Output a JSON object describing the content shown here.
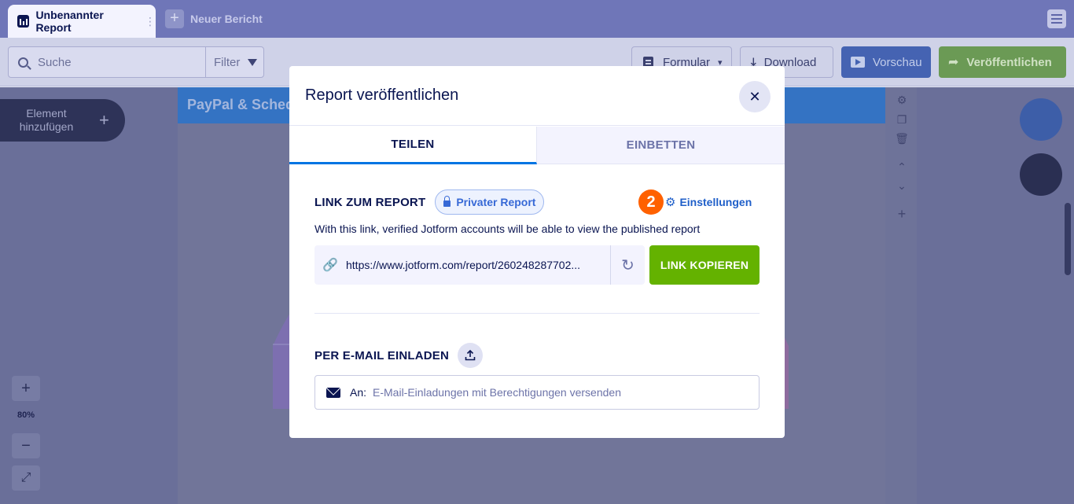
{
  "tabs": {
    "active_tab": "Unbenannter Report",
    "new_tab": "Neuer Bericht"
  },
  "toolbar": {
    "search_placeholder": "Suche",
    "filter_label": "Filter",
    "formular_label": "Formular",
    "download_label": "Download",
    "preview_label": "Vorschau",
    "publish_label": "Veröffentlichen"
  },
  "left_panel": {
    "add_element_label": "Element hinzufügen",
    "zoom_in": "+",
    "zoom_level": "80%",
    "zoom_out": "−"
  },
  "canvas": {
    "banner_title": "PayPal & Sched"
  },
  "modal": {
    "title": "Report veröffentlichen",
    "close_icon": "close-icon",
    "tab_share": "TEILEN",
    "tab_embed": "EINBETTEN",
    "link_section_title": "LINK ZUM REPORT",
    "private_badge": "Privater Report",
    "step_number": "2",
    "settings_label": "Einstellungen",
    "helper_text": "With this link, verified Jotform accounts will be able to view the published report",
    "report_url": "https://www.jotform.com/report/260248287702...",
    "copy_button": "LINK KOPIEREN",
    "email_section_title": "PER E-MAIL EINLADEN",
    "email_prefix": "An:",
    "email_placeholder": "E-Mail-Einladungen mit Berechtigungen versenden"
  },
  "colors": {
    "accent_blue": "#0075e3",
    "primary_green": "#64b200",
    "step_orange": "#ff6100",
    "navy_text": "#0a1551"
  }
}
